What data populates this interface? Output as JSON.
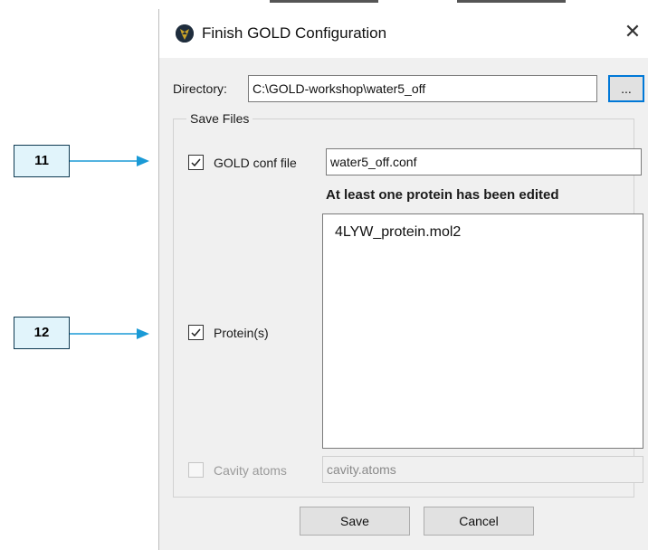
{
  "window": {
    "title": "Finish GOLD Configuration",
    "icon": "gold-logo-icon",
    "close_icon": "close-icon"
  },
  "directory": {
    "label": "Directory:",
    "value": "C:\\GOLD-workshop\\water5_off",
    "browse_label": "..."
  },
  "save_files": {
    "legend": "Save Files",
    "gold_conf": {
      "label": "GOLD conf file",
      "checked": true,
      "value": "water5_off.conf"
    },
    "proteins": {
      "notice": "At least one protein has been edited",
      "label": "Protein(s)",
      "checked": true,
      "items": [
        "4LYW_protein.mol2"
      ]
    },
    "cavity": {
      "label": "Cavity atoms",
      "checked": false,
      "enabled": false,
      "value": "cavity.atoms"
    }
  },
  "buttons": {
    "save": "Save",
    "cancel": "Cancel"
  },
  "callouts": {
    "gold_conf": "11",
    "proteins": "12"
  },
  "colors": {
    "arrow": "#1a9ad6",
    "callout_fill": "#e1f4fb",
    "focus_border": "#0078d7"
  }
}
